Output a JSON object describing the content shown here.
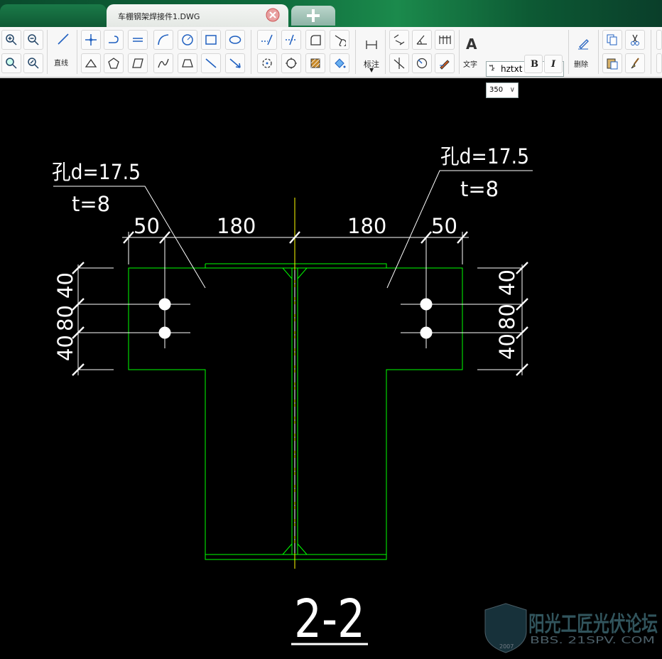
{
  "tab": {
    "title": "车棚钢架焊接件1.DWG",
    "new_tab": "+"
  },
  "toolbar": {
    "line_label": "直线",
    "dim_label": "标注",
    "text_label": "文字",
    "delete_label": "删除",
    "font_value": "hztxt",
    "size_value": "350",
    "bold": "B",
    "italic": "I",
    "text_icon": "A"
  },
  "drawing": {
    "hole_left": "孔d=17.5",
    "thick_left": "t=8",
    "hole_right": "孔d=17.5",
    "thick_right": "t=8",
    "dim_50_left": "50",
    "dim_180_left": "180",
    "dim_180_right": "180",
    "dim_50_right": "50",
    "v_left_top": "40",
    "v_left_mid": "80",
    "v_left_bot": "40",
    "v_right_top": "40",
    "v_right_mid": "80",
    "v_right_bot": "40",
    "section_label": "2-2"
  },
  "watermark": {
    "text": "阳光工匠光伏论坛",
    "url": "BBS. 21SPV. COM",
    "year": "2007"
  },
  "colors": {
    "canvas": "#000000",
    "geometry": "#00ff00",
    "annotation": "#ffffff",
    "centerline": "#ffff00"
  }
}
